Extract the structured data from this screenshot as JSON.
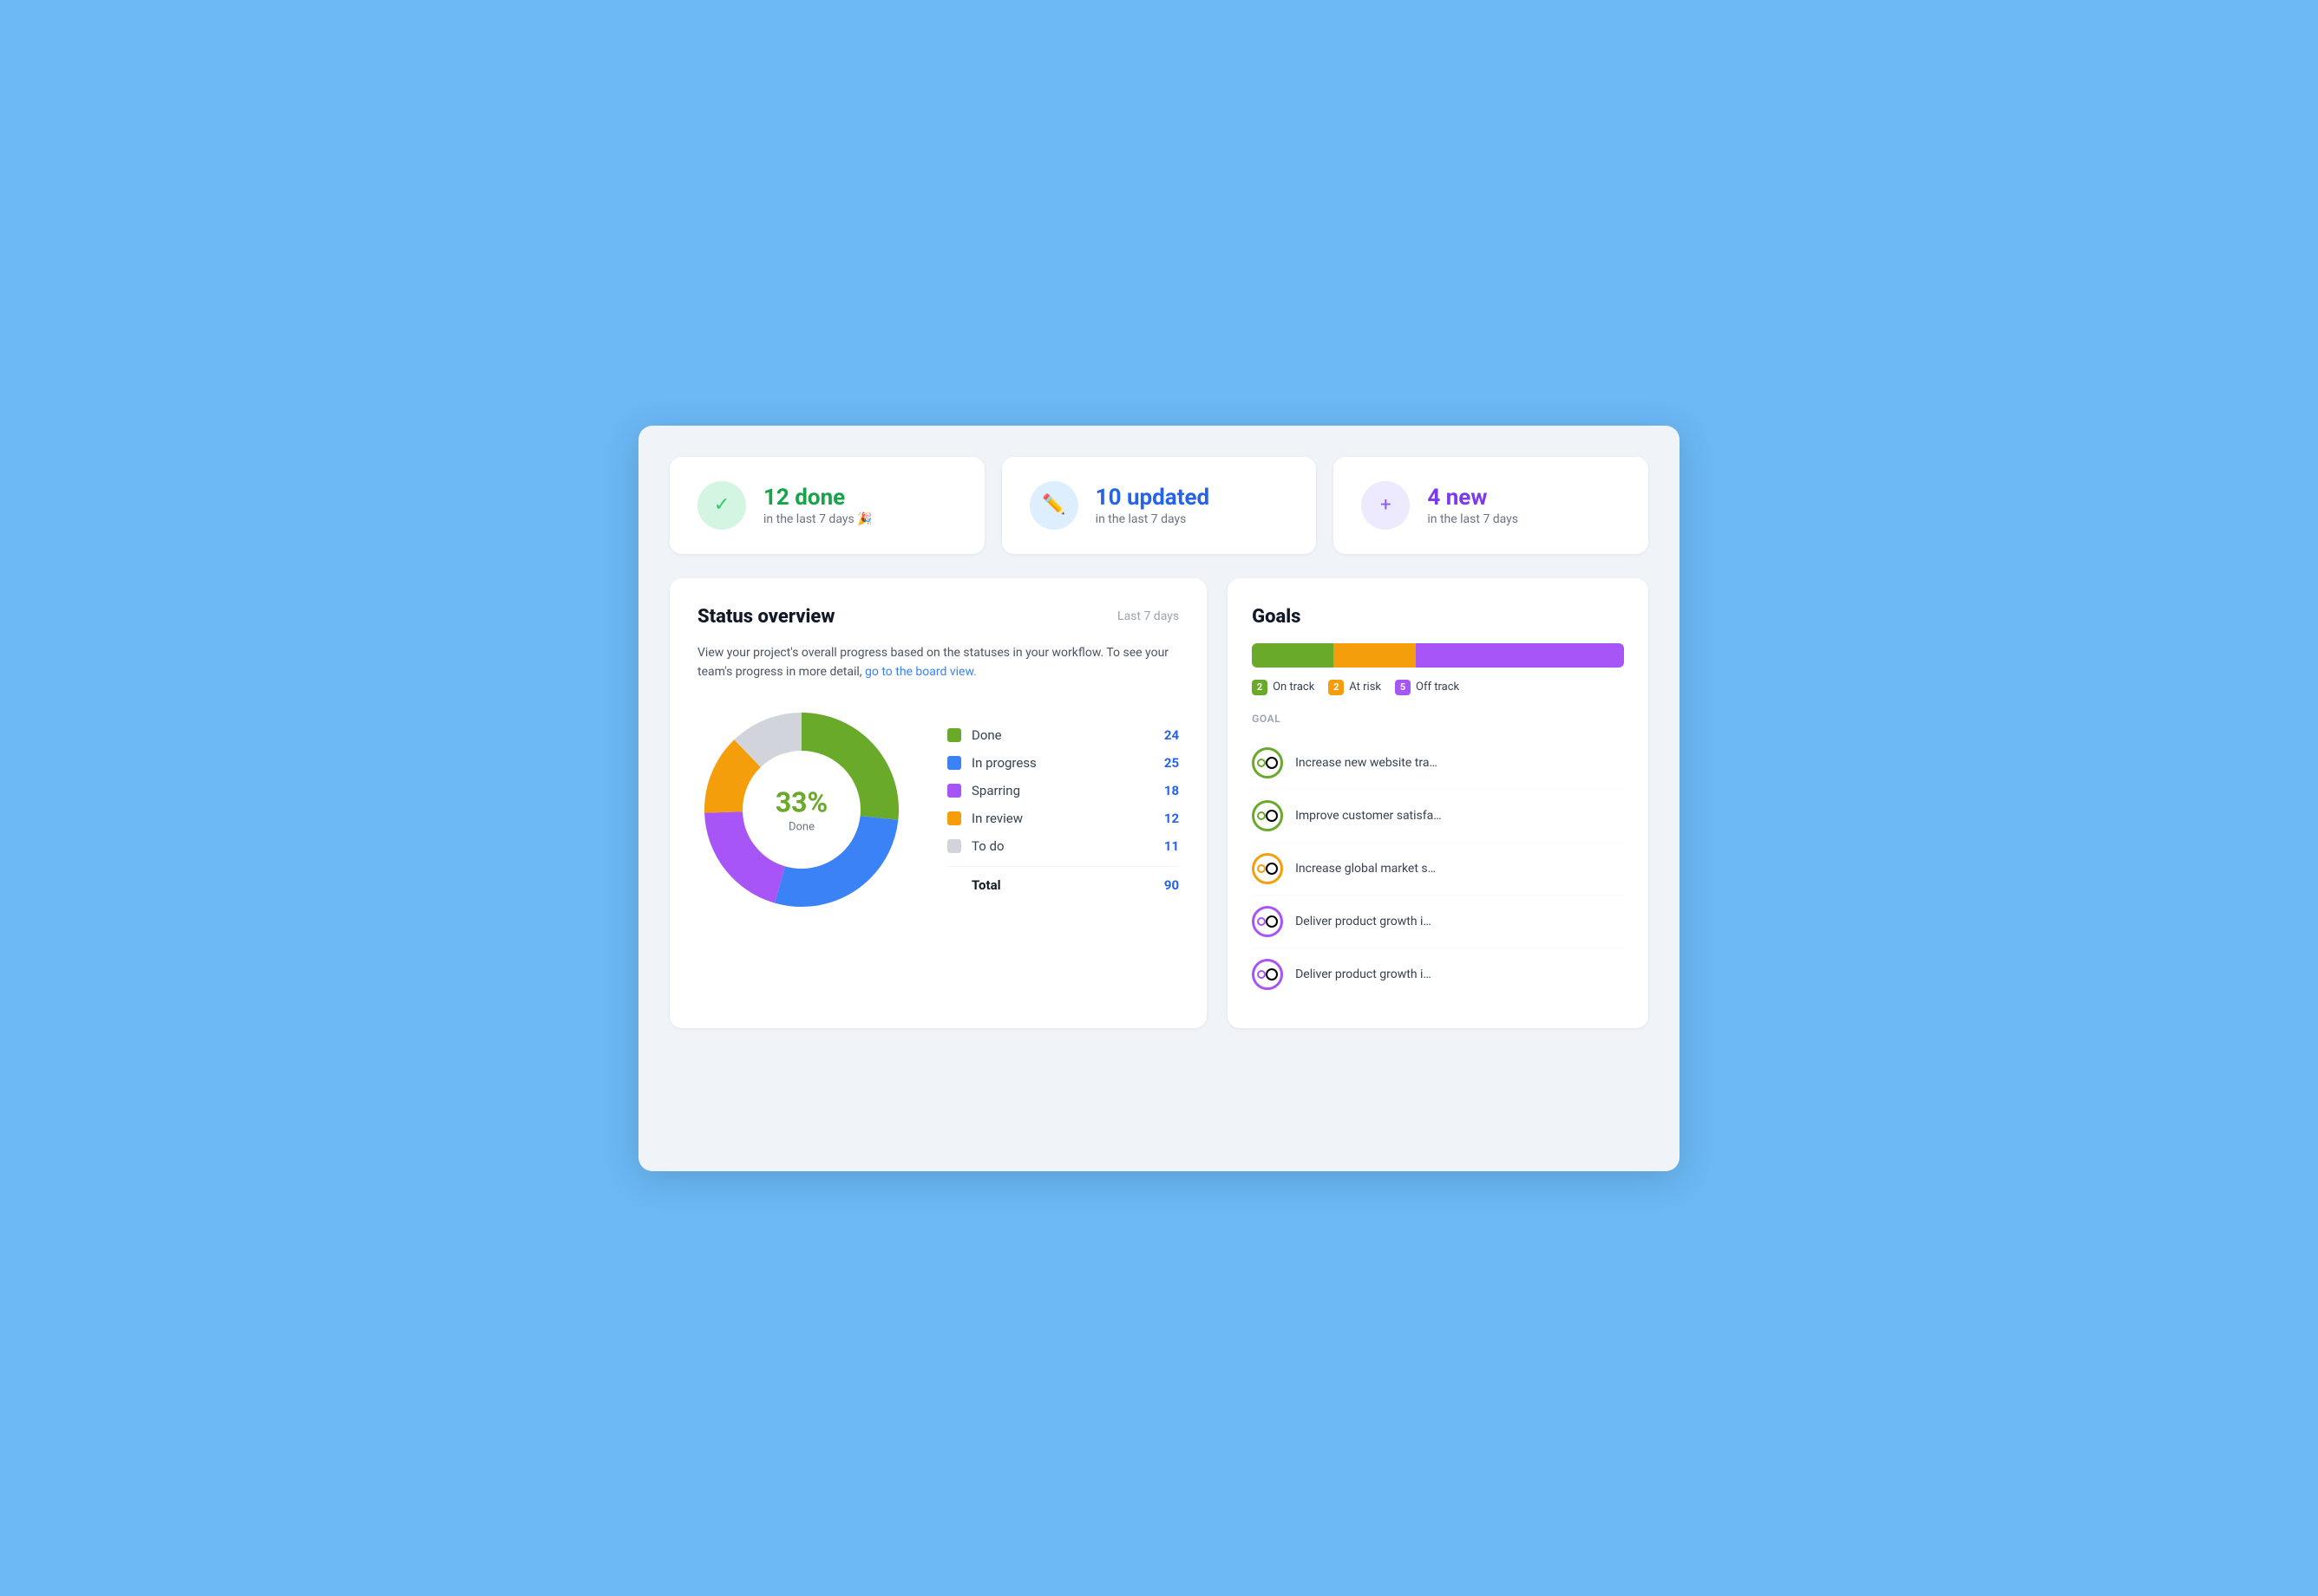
{
  "stat_cards": [
    {
      "id": "done",
      "icon_type": "check",
      "icon_class": "green",
      "main_label": "12 done",
      "main_class": "green",
      "sub_label": "in the last 7 days 🎉"
    },
    {
      "id": "updated",
      "icon_type": "pencil",
      "icon_class": "blue",
      "main_label": "10 updated",
      "main_class": "blue",
      "sub_label": "in the last 7 days"
    },
    {
      "id": "new",
      "icon_type": "plus",
      "icon_class": "purple",
      "main_label": "4 new",
      "main_class": "purple",
      "sub_label": "in the last 7 days"
    }
  ],
  "status_overview": {
    "title": "Status overview",
    "period": "Last 7 days",
    "description": "View your project's overall progress based on the statuses in your workflow. To see your team's progress in more detail,",
    "link_text": "go to the board view.",
    "donut_percent": "33%",
    "donut_center_label": "Done",
    "legend": [
      {
        "name": "Done",
        "color": "#6aaa2a",
        "value": "24"
      },
      {
        "name": "In progress",
        "color": "#3b82f6",
        "value": "25"
      },
      {
        "name": "Sparring",
        "color": "#a855f7",
        "value": "18"
      },
      {
        "name": "In review",
        "color": "#f59e0b",
        "value": "12"
      },
      {
        "name": "To do",
        "color": "#d1d5db",
        "value": "11"
      }
    ],
    "total_label": "Total",
    "total_value": "90"
  },
  "goals": {
    "title": "Goals",
    "progress_segments": [
      {
        "color": "#6aaa2a",
        "width": 22
      },
      {
        "color": "#f59e0b",
        "width": 22
      },
      {
        "color": "#a855f7",
        "width": 56
      }
    ],
    "legend": [
      {
        "label": "On track",
        "count": "2",
        "color": "#6aaa2a"
      },
      {
        "label": "At risk",
        "count": "2",
        "color": "#f59e0b"
      },
      {
        "label": "Off track",
        "count": "5",
        "color": "#a855f7"
      }
    ],
    "col_header": "Goal",
    "items": [
      {
        "name": "Increase new website tra…",
        "icon_color": "#6aaa2a",
        "inner_color": "#6aaa2a"
      },
      {
        "name": "Improve customer satisfa…",
        "icon_color": "#6aaa2a",
        "inner_color": "#6aaa2a"
      },
      {
        "name": "Increase global market s…",
        "icon_color": "#f59e0b",
        "inner_color": "#f59e0b"
      },
      {
        "name": "Deliver product growth i…",
        "icon_color": "#a855f7",
        "inner_color": "#a855f7"
      },
      {
        "name": "Deliver product growth i…",
        "icon_color": "#a855f7",
        "inner_color": "#a855f7"
      }
    ]
  }
}
